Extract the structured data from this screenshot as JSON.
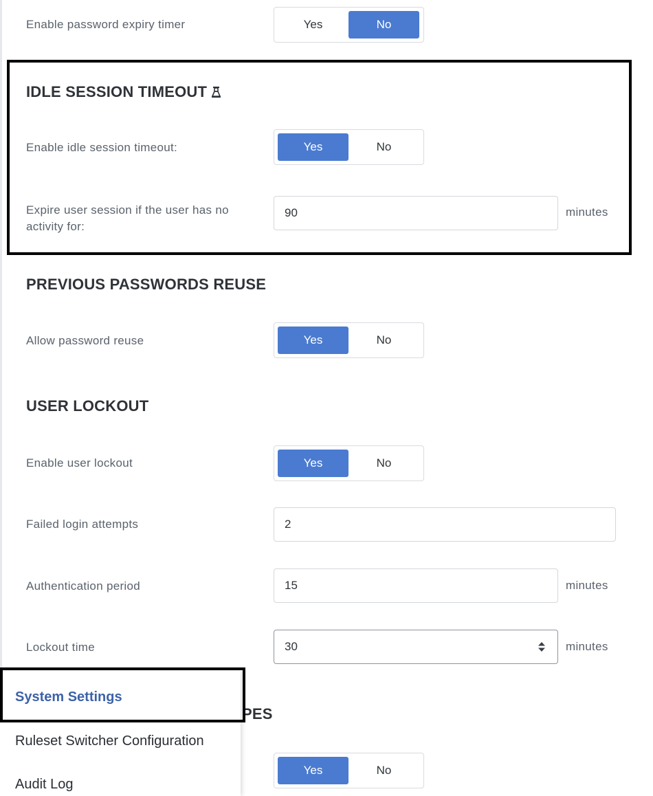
{
  "password_expiry": {
    "label": "Enable password expiry timer",
    "yes": "Yes",
    "no": "No",
    "selected": "No"
  },
  "idle_session": {
    "title": "IDLE SESSION TIMEOUT",
    "title_icon": "flask-icon",
    "enable_label": "Enable idle session timeout:",
    "yes": "Yes",
    "no": "No",
    "selected": "Yes",
    "expire_label_line1": "Expire user session if the user has no",
    "expire_label_line2": "activity for:",
    "expire_value": "90",
    "expire_unit": "minutes"
  },
  "password_reuse": {
    "title": "PREVIOUS PASSWORDS REUSE",
    "allow_label": "Allow password reuse",
    "yes": "Yes",
    "no": "No",
    "selected": "Yes"
  },
  "user_lockout": {
    "title": "USER LOCKOUT",
    "enable_label": "Enable user lockout",
    "yes": "Yes",
    "no": "No",
    "selected": "Yes",
    "failed_attempts_label": "Failed login attempts",
    "failed_attempts_value": "2",
    "auth_period_label": "Authentication period",
    "auth_period_value": "15",
    "auth_period_unit": "minutes",
    "lockout_time_label": "Lockout time",
    "lockout_time_value": "30",
    "lockout_time_unit": "minutes"
  },
  "partial_section": {
    "title_fragment": "PES",
    "yes": "Yes",
    "no": "No",
    "selected": "Yes"
  },
  "menu": {
    "items": [
      {
        "label": "System Settings",
        "active": true
      },
      {
        "label": "Ruleset Switcher Configuration",
        "active": false
      },
      {
        "label": "Audit Log",
        "active": false
      }
    ]
  },
  "colors": {
    "accent": "#4a7bd0",
    "menu_active": "#3d62a8",
    "highlight_border": "#000000"
  }
}
